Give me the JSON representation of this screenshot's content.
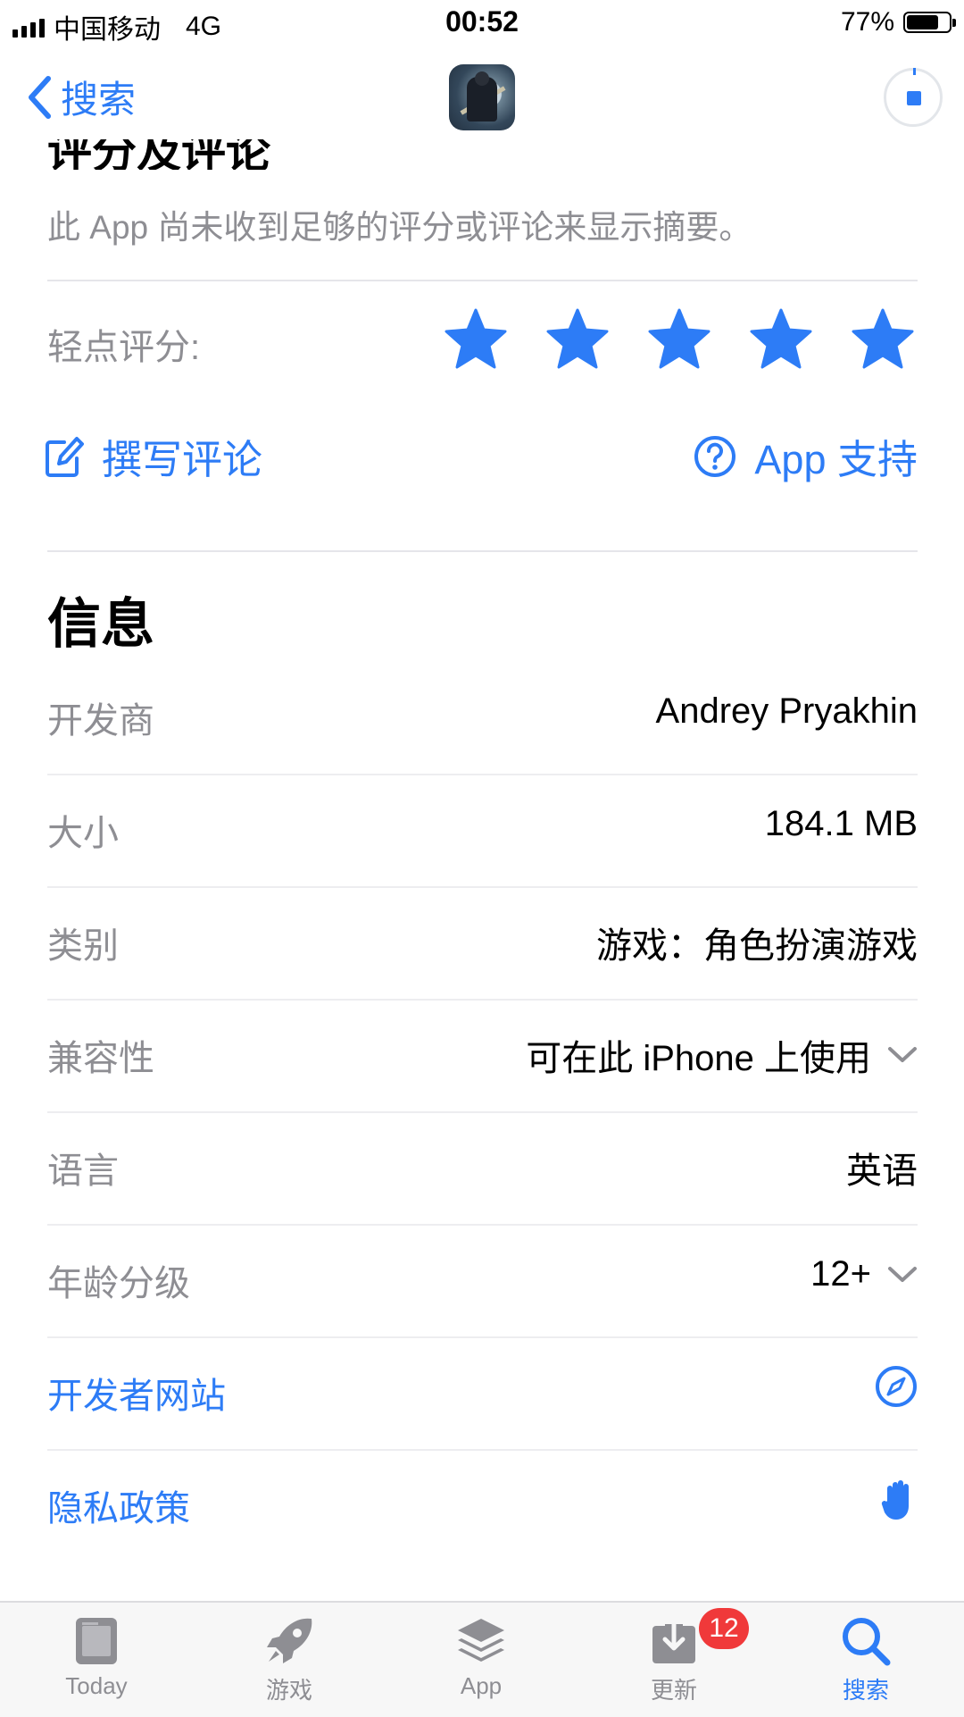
{
  "status_bar": {
    "carrier": "中国移动",
    "network": "4G",
    "time": "00:52",
    "battery": "77%",
    "battery_level": 0.77
  },
  "nav": {
    "back_label": "搜索",
    "app_icon": "game-app-icon",
    "download_state": "downloading"
  },
  "ratings": {
    "title": "评分及评论",
    "summary": "此 App 尚未收到足够的评分或评论来显示摘要。",
    "tap_to_rate": "轻点评分:",
    "stars_count": 5,
    "write_review": "撰写评论",
    "app_support": "App 支持"
  },
  "info": {
    "title": "信息",
    "rows": [
      {
        "label": "开发商",
        "value": "Andrey Pryakhin"
      },
      {
        "label": "大小",
        "value": "184.1 MB"
      },
      {
        "label": "类别",
        "value": "游戏：角色扮演游戏"
      },
      {
        "label": "兼容性",
        "value": "可在此 iPhone 上使用"
      },
      {
        "label": "语言",
        "value": "英语"
      },
      {
        "label": "年龄分级",
        "value": "12+"
      }
    ],
    "developer_website": "开发者网站",
    "privacy_policy": "隐私政策"
  },
  "tabbar": {
    "tabs": [
      {
        "label": "Today",
        "icon": "today-icon"
      },
      {
        "label": "游戏",
        "icon": "rocket-icon"
      },
      {
        "label": "App",
        "icon": "layers-icon"
      },
      {
        "label": "更新",
        "icon": "download-icon"
      },
      {
        "label": "搜索",
        "icon": "search-icon"
      }
    ],
    "active_tab": "搜索",
    "updates_badge": "12"
  },
  "colors": {
    "accent": "#2d7cf6",
    "secondary_text": "#8e8e93",
    "badge": "#f0393a"
  }
}
